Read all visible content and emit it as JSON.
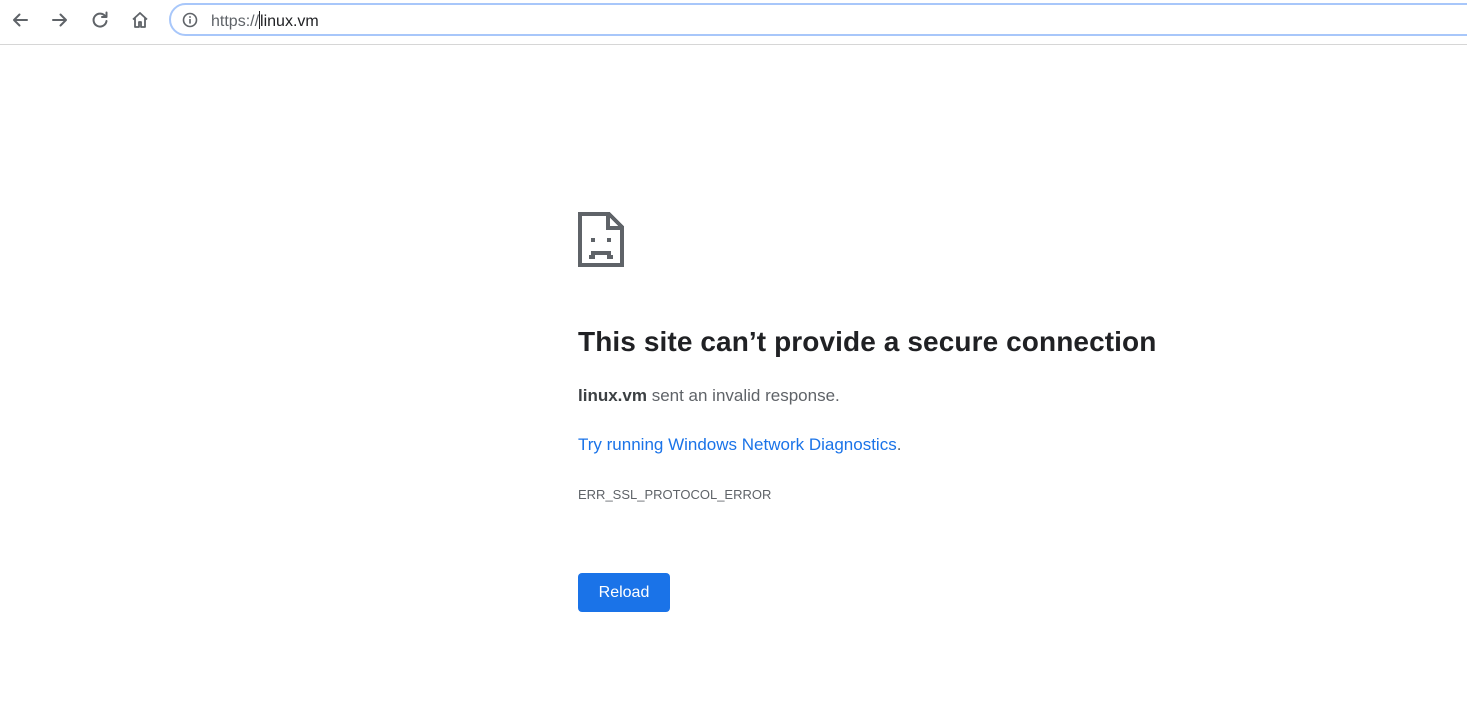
{
  "browser": {
    "url_scheme": "https://",
    "url_host": "linux.vm",
    "icons": {
      "back": "arrow-left-icon",
      "forward": "arrow-right-icon",
      "reload": "refresh-icon",
      "home": "home-icon",
      "site_info": "info-circle-icon"
    }
  },
  "error_page": {
    "icon": "sad-page-icon",
    "headline": "This site can’t provide a secure connection",
    "host": "linux.vm",
    "summary_rest": " sent an invalid response.",
    "suggestion_link": "Try running Windows Network Diagnostics",
    "suggestion_tail": ".",
    "error_code": "ERR_SSL_PROTOCOL_ERROR",
    "reload_label": "Reload"
  },
  "colors": {
    "link": "#1a73e8",
    "button_bg": "#1a73e8",
    "omnibox_border": "#a8c7fa",
    "heading": "#202124",
    "body_text": "#5f6368"
  }
}
